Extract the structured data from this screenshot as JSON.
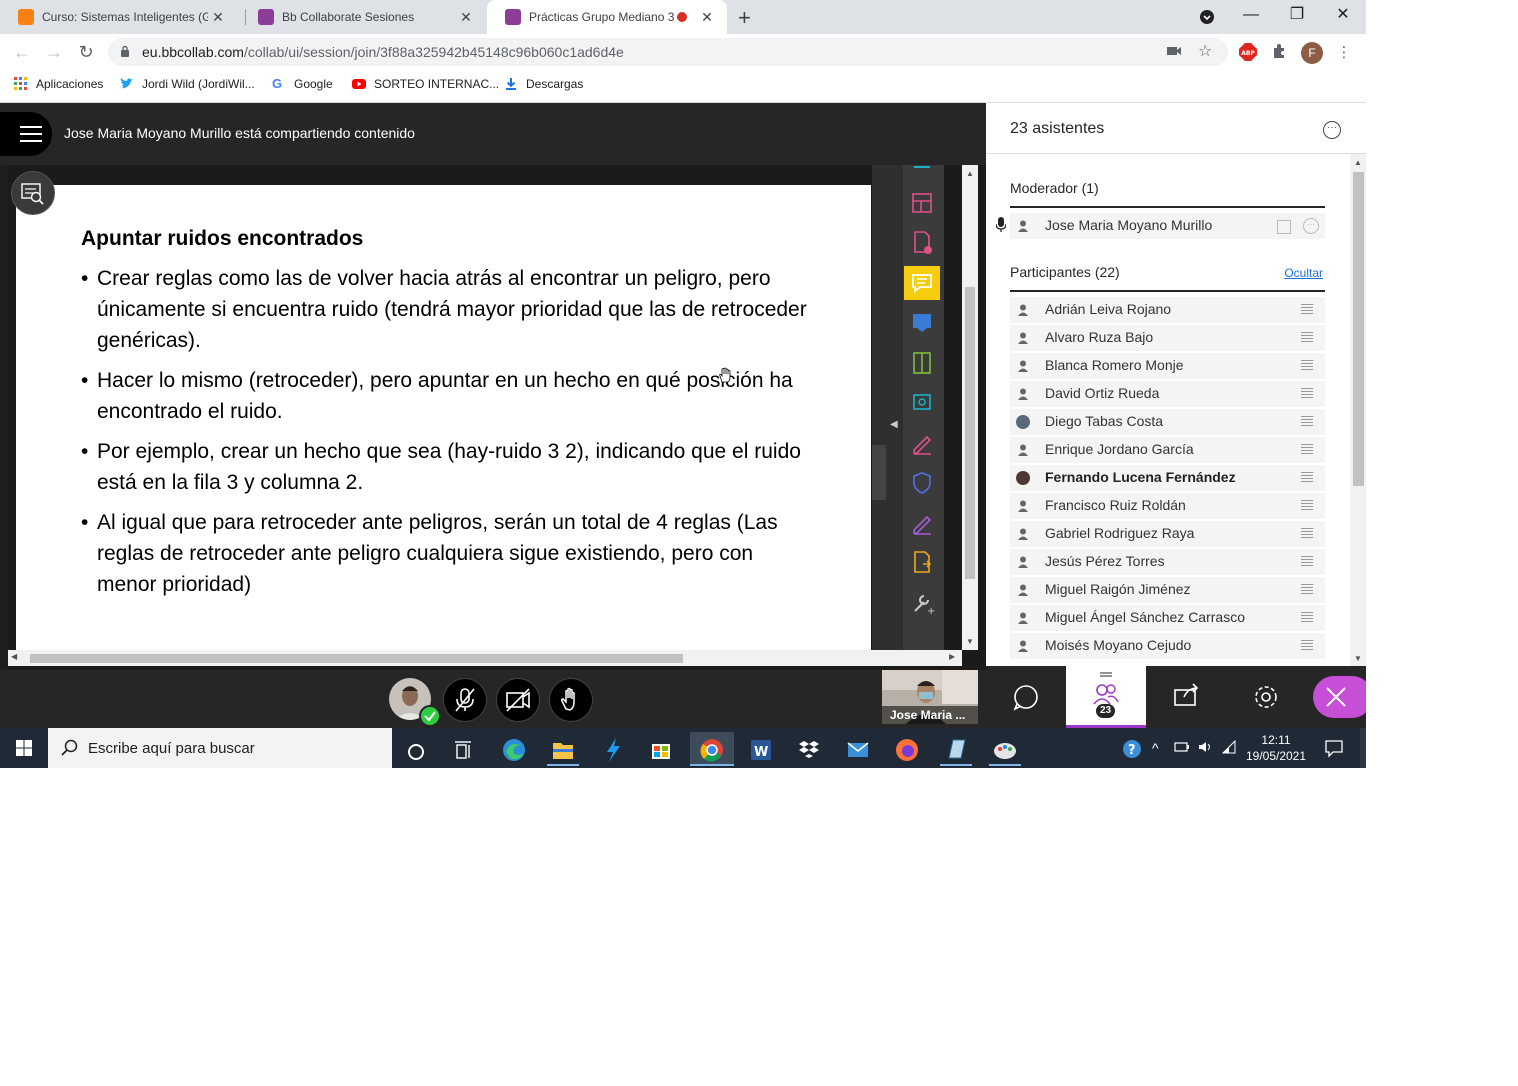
{
  "browser": {
    "tabs": [
      {
        "title": "Curso: Sistemas Inteligentes (GIIN",
        "favicon_color": "#f98012",
        "active": false
      },
      {
        "title": "Bb Collaborate Sesiones",
        "favicon_color": "#8c3d96",
        "active": false
      },
      {
        "title": "Prácticas Grupo Mediano 3 -",
        "favicon_color": "#8c3d96",
        "active": true
      }
    ],
    "url_host": "eu.bbcollab.com",
    "url_path": "/collab/ui/session/join/3f88a325942b45148c96b060c1ad6d4e",
    "profile_initial": "F",
    "bookmarks": [
      {
        "label": "Aplicaciones",
        "icon": "apps-grid-icon"
      },
      {
        "label": "Jordi Wild (JordiWil...",
        "icon": "twitter-icon"
      },
      {
        "label": "Google",
        "icon": "google-icon"
      },
      {
        "label": "SORTEO INTERNAC...",
        "icon": "youtube-icon"
      },
      {
        "label": "Descargas",
        "icon": "download-icon"
      }
    ]
  },
  "collab": {
    "sharing_text": "Jose Maria Moyano Murillo está compartiendo contenido",
    "slide": {
      "heading": "Apuntar ruidos encontrados",
      "bullets": [
        "Crear reglas como las de volver hacia atrás al encontrar un peligro, pero únicamente si encuentra ruido (tendrá mayor prioridad que las de retroceder genéricas).",
        "Hacer lo mismo (retroceder), pero apuntar en un hecho en qué posición ha encontrado el ruido.",
        "Por ejemplo, crear un hecho que sea (hay-ruido 3 2), indicando que el ruido está en la fila 3 y columna 2.",
        "Al igual que para retroceder ante peligros, serán un total de 4 reglas (Las reglas de retroceder ante peligro cualquiera sigue existiendo, pero con menor prioridad)"
      ]
    },
    "video_name": "Jose Maria ..."
  },
  "panel": {
    "title": "23 asistentes",
    "moderator_header": "Moderador (1)",
    "moderator": "Jose Maria Moyano Murillo",
    "participants_header": "Participantes (22)",
    "hide_label": "Ocultar",
    "participants": [
      "Adrián Leiva Rojano",
      "Alvaro Ruza Bajo",
      "Blanca Romero Monje",
      "David Ortiz Rueda",
      "Diego Tabas Costa",
      "Enrique Jordano García",
      "Fernando Lucena Fernández",
      "Francisco Ruiz Roldán",
      "Gabriel Rodriguez Raya",
      "Jesús Pérez Torres",
      "Miguel Raigón Jiménez",
      "Miguel Ángel Sánchez Carrasco",
      "Moisés Moyano Cejudo"
    ],
    "attendee_count": "23"
  },
  "taskbar": {
    "search_placeholder": "Escribe aquí para buscar",
    "time": "12:11",
    "date": "19/05/2021"
  },
  "colors": {
    "accent_purple": "#9d36c7",
    "close_pink": "#c74ed6",
    "active_tool_yellow": "#f5cd0c"
  }
}
